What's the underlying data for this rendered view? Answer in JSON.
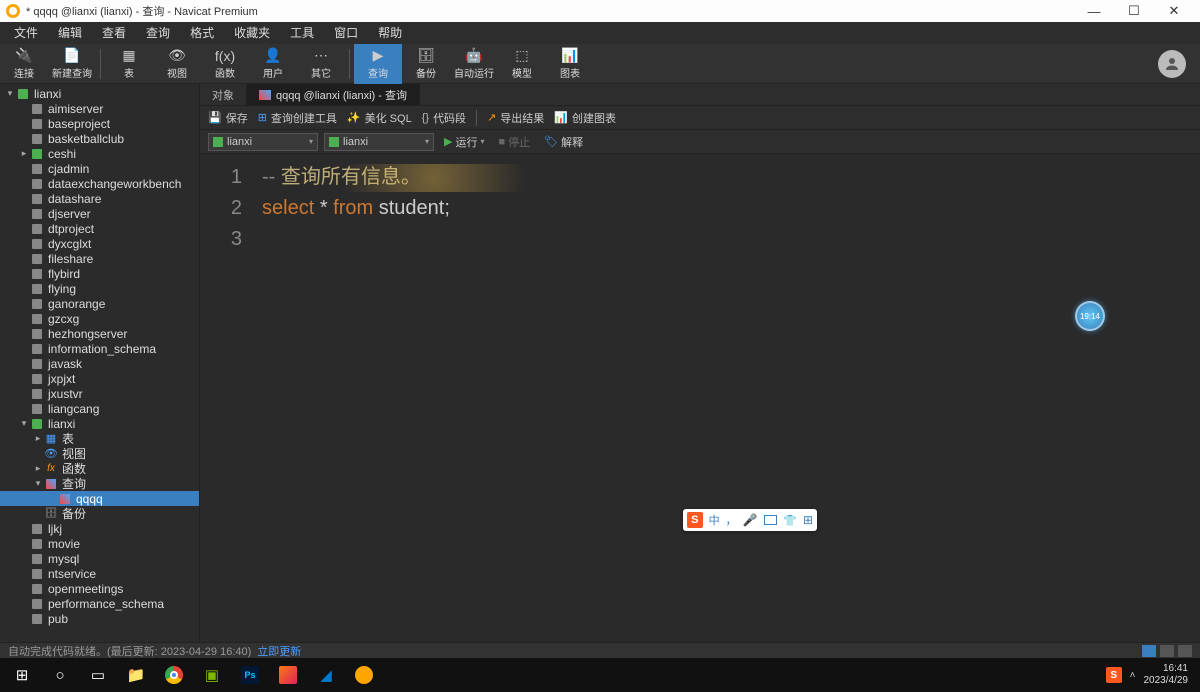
{
  "window": {
    "title": "* qqqq @lianxi (lianxi) - 查询 - Navicat Premium"
  },
  "menu": [
    "文件",
    "编辑",
    "查看",
    "查询",
    "格式",
    "收藏夹",
    "工具",
    "窗口",
    "帮助"
  ],
  "toolbar": [
    {
      "label": "连接",
      "icon": "🔌"
    },
    {
      "label": "新建查询",
      "icon": "📄"
    },
    {
      "label": "表",
      "icon": "▦"
    },
    {
      "label": "视图",
      "icon": "👁"
    },
    {
      "label": "函数",
      "icon": "f(x)"
    },
    {
      "label": "用户",
      "icon": "👤"
    },
    {
      "label": "其它",
      "icon": "⋯"
    },
    {
      "label": "查询",
      "icon": "▶",
      "active": true
    },
    {
      "label": "备份",
      "icon": "🗄"
    },
    {
      "label": "自动运行",
      "icon": "🤖"
    },
    {
      "label": "模型",
      "icon": "⬚"
    },
    {
      "label": "图表",
      "icon": "📊"
    }
  ],
  "tree": [
    {
      "label": "lianxi",
      "lvl": 0,
      "arrow": "▾",
      "icon": "db-green"
    },
    {
      "label": "aimiserver",
      "lvl": 1,
      "icon": "db-gray"
    },
    {
      "label": "baseproject",
      "lvl": 1,
      "icon": "db-gray"
    },
    {
      "label": "basketballclub",
      "lvl": 1,
      "icon": "db-gray"
    },
    {
      "label": "ceshi",
      "lvl": 1,
      "arrow": "▸",
      "icon": "db-green"
    },
    {
      "label": "cjadmin",
      "lvl": 1,
      "icon": "db-gray"
    },
    {
      "label": "dataexchangeworkbench",
      "lvl": 1,
      "icon": "db-gray"
    },
    {
      "label": "datashare",
      "lvl": 1,
      "icon": "db-gray"
    },
    {
      "label": "djserver",
      "lvl": 1,
      "icon": "db-gray"
    },
    {
      "label": "dtproject",
      "lvl": 1,
      "icon": "db-gray"
    },
    {
      "label": "dyxcglxt",
      "lvl": 1,
      "icon": "db-gray"
    },
    {
      "label": "fileshare",
      "lvl": 1,
      "icon": "db-gray"
    },
    {
      "label": "flybird",
      "lvl": 1,
      "icon": "db-gray"
    },
    {
      "label": "flying",
      "lvl": 1,
      "icon": "db-gray"
    },
    {
      "label": "ganorange",
      "lvl": 1,
      "icon": "db-gray"
    },
    {
      "label": "gzcxg",
      "lvl": 1,
      "icon": "db-gray"
    },
    {
      "label": "hezhongserver",
      "lvl": 1,
      "icon": "db-gray"
    },
    {
      "label": "information_schema",
      "lvl": 1,
      "icon": "db-gray"
    },
    {
      "label": "javask",
      "lvl": 1,
      "icon": "db-gray"
    },
    {
      "label": "jxpjxt",
      "lvl": 1,
      "icon": "db-gray"
    },
    {
      "label": "jxustvr",
      "lvl": 1,
      "icon": "db-gray"
    },
    {
      "label": "liangcang",
      "lvl": 1,
      "icon": "db-gray"
    },
    {
      "label": "lianxi",
      "lvl": 1,
      "arrow": "▾",
      "icon": "db-green"
    },
    {
      "label": "表",
      "lvl": 2,
      "arrow": "▸",
      "icon": "tbl-blue",
      "glyph": "▦"
    },
    {
      "label": "视图",
      "lvl": 2,
      "icon": "view-blue",
      "glyph": "👁"
    },
    {
      "label": "函数",
      "lvl": 2,
      "arrow": "▸",
      "icon": "fx-orange",
      "glyph": "fx"
    },
    {
      "label": "查询",
      "lvl": 2,
      "arrow": "▾",
      "icon": "query-icon"
    },
    {
      "label": "qqqq",
      "lvl": 3,
      "icon": "query-icon",
      "sel": true
    },
    {
      "label": "备份",
      "lvl": 2,
      "icon": "backup-icon",
      "glyph": "🗄"
    },
    {
      "label": "ljkj",
      "lvl": 1,
      "icon": "db-gray"
    },
    {
      "label": "movie",
      "lvl": 1,
      "icon": "db-gray"
    },
    {
      "label": "mysql",
      "lvl": 1,
      "icon": "db-gray"
    },
    {
      "label": "ntservice",
      "lvl": 1,
      "icon": "db-gray"
    },
    {
      "label": "openmeetings",
      "lvl": 1,
      "icon": "db-gray"
    },
    {
      "label": "performance_schema",
      "lvl": 1,
      "icon": "db-gray"
    },
    {
      "label": "pub",
      "lvl": 1,
      "icon": "db-gray"
    }
  ],
  "tabs": {
    "obj": "对象",
    "active": "qqqq @lianxi (lianxi) - 查询"
  },
  "qbar1": {
    "save": "保存",
    "builder": "查询创建工具",
    "beautify": "美化 SQL",
    "snippet": "代码段",
    "export": "导出结果",
    "chart": "创建图表"
  },
  "qbar2": {
    "conn": "lianxi",
    "db": "lianxi",
    "run": "运行",
    "stop": "停止",
    "explain": "解释"
  },
  "code": {
    "l1": {
      "dash": "--",
      "comment": "查询所有信息。"
    },
    "l2": {
      "select": "select",
      "star": "*",
      "from": "from",
      "tbl": "student",
      "semi": ";"
    },
    "lines": [
      "1",
      "2",
      "3"
    ]
  },
  "status": {
    "left": "自动完成代码就绪。(最后更新: 2023-04-29 16:40)",
    "link": "立即更新"
  },
  "ime": {
    "zh": "中",
    "comma": "，"
  },
  "clock": "19:14",
  "taskbar": {
    "time": "16:41",
    "date": "2023/4/29"
  }
}
